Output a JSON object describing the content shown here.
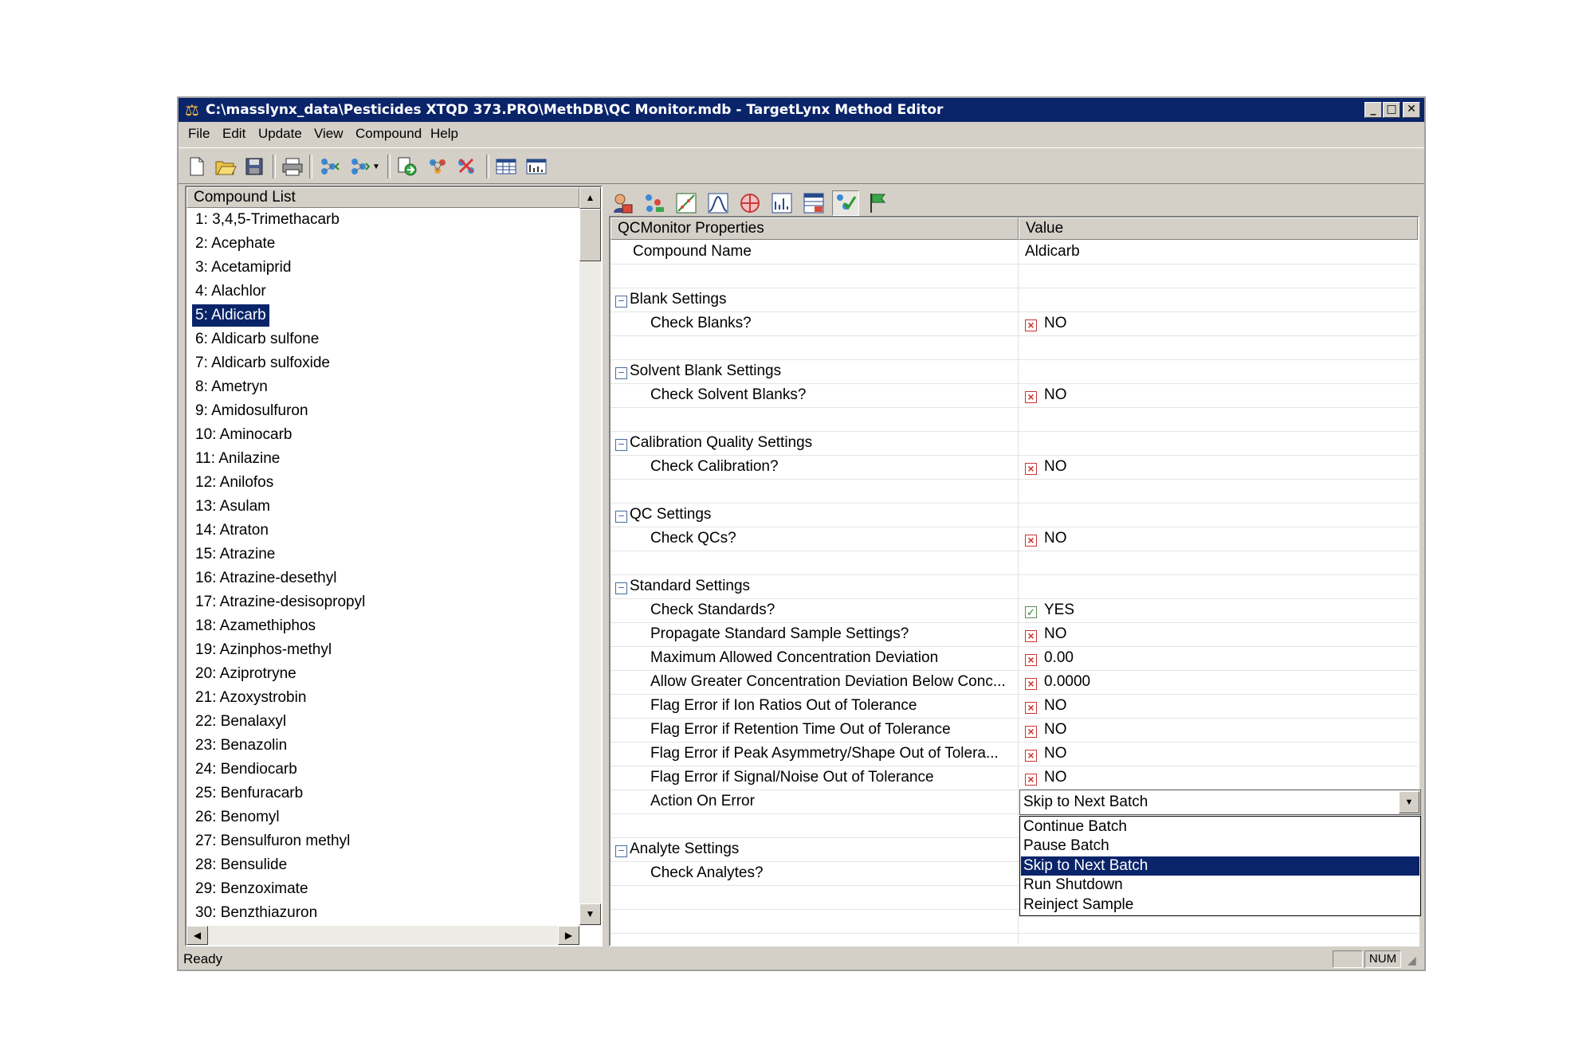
{
  "window": {
    "title": "C:\\masslynx_data\\Pesticides XTQD 373.PRO\\MethDB\\QC Monitor.mdb - TargetLynx Method Editor",
    "minimize_icon": "minimize-icon",
    "maximize_icon": "maximize-icon",
    "close_icon": "close-icon"
  },
  "menu": [
    "File",
    "Edit",
    "Update",
    "View",
    "Compound",
    "Help"
  ],
  "toolbar_icons": [
    "new-icon",
    "open-icon",
    "save-icon",
    "print-icon",
    "prev-compound-icon",
    "next-compound-icon",
    "dropdown-arrow-icon",
    "import-icon",
    "add-compound-icon",
    "delete-compound-icon",
    "table-view-icon",
    "chart-view-icon"
  ],
  "compound_list": {
    "header": "Compound List",
    "selected_index": 4,
    "items": [
      "1: 3,4,5-Trimethacarb",
      "2: Acephate",
      "3: Acetamiprid",
      "4: Alachlor",
      "5: Aldicarb",
      "6: Aldicarb sulfone",
      "7: Aldicarb sulfoxide",
      "8: Ametryn",
      "9: Amidosulfuron",
      "10: Aminocarb",
      "11: Anilazine",
      "12: Anilofos",
      "13: Asulam",
      "14: Atraton",
      "15: Atrazine",
      "16: Atrazine-desethyl",
      "17: Atrazine-desisopropyl",
      "18: Azamethiphos",
      "19: Azinphos-methyl",
      "20: Aziprotryne",
      "21: Azoxystrobin",
      "22: Benalaxyl",
      "23: Benazolin",
      "24: Bendiocarb",
      "25: Benfuracarb",
      "26: Benomyl",
      "27: Bensulfuron methyl",
      "28: Bensulide",
      "29: Benzoximate",
      "30: Benzthiazuron"
    ]
  },
  "property_toolbar_icons": [
    "compound-icon",
    "peaks-icon",
    "calibration-icon",
    "integration-icon",
    "target-icon",
    "report-icon",
    "database-icon",
    "qc-monitor-icon",
    "flag-icon"
  ],
  "grid": {
    "col_property": "QCMonitor Properties",
    "col_value": "Value",
    "rows": [
      {
        "type": "prop",
        "name": "Compound Name",
        "value": "Aldicarb",
        "check": ""
      },
      {
        "type": "blank"
      },
      {
        "type": "group",
        "name": "Blank Settings"
      },
      {
        "type": "prop",
        "name": "Check Blanks?",
        "value": "NO",
        "check": "x"
      },
      {
        "type": "blank"
      },
      {
        "type": "group",
        "name": "Solvent Blank Settings"
      },
      {
        "type": "prop",
        "name": "Check Solvent Blanks?",
        "value": "NO",
        "check": "x"
      },
      {
        "type": "blank"
      },
      {
        "type": "group",
        "name": "Calibration Quality Settings"
      },
      {
        "type": "prop",
        "name": "Check Calibration?",
        "value": "NO",
        "check": "x"
      },
      {
        "type": "blank"
      },
      {
        "type": "group",
        "name": "QC Settings"
      },
      {
        "type": "prop",
        "name": "Check QCs?",
        "value": "NO",
        "check": "x"
      },
      {
        "type": "blank"
      },
      {
        "type": "group",
        "name": "Standard Settings"
      },
      {
        "type": "prop",
        "name": "Check Standards?",
        "value": "YES",
        "check": "v"
      },
      {
        "type": "prop",
        "name": "Propagate Standard Sample Settings?",
        "value": "NO",
        "check": "x"
      },
      {
        "type": "prop",
        "name": "Maximum Allowed Concentration Deviation",
        "value": "0.00",
        "check": "x"
      },
      {
        "type": "prop",
        "name": "Allow Greater Concentration Deviation Below Conc...",
        "value": "0.0000",
        "check": "x"
      },
      {
        "type": "prop",
        "name": "Flag Error if Ion Ratios Out of Tolerance",
        "value": "NO",
        "check": "x"
      },
      {
        "type": "prop",
        "name": "Flag Error if Retention Time Out of Tolerance",
        "value": "NO",
        "check": "x"
      },
      {
        "type": "prop",
        "name": "Flag Error if Peak Asymmetry/Shape Out of Tolera...",
        "value": "NO",
        "check": "x"
      },
      {
        "type": "prop",
        "name": "Flag Error if Signal/Noise Out of Tolerance",
        "value": "NO",
        "check": "x"
      },
      {
        "type": "prop",
        "name": "Action On Error",
        "value": "",
        "check": ""
      },
      {
        "type": "blank"
      },
      {
        "type": "group",
        "name": "Analyte Settings"
      },
      {
        "type": "prop",
        "name": "Check Analytes?",
        "value": "",
        "check": ""
      },
      {
        "type": "blank"
      },
      {
        "type": "blank"
      }
    ]
  },
  "action_on_error": {
    "selected": "Skip to Next Batch",
    "options": [
      "Continue Batch",
      "Pause Batch",
      "Skip to Next Batch",
      "Run Shutdown",
      "Reinject Sample"
    ],
    "selected_index": 2
  },
  "status": {
    "text": "Ready",
    "num": "NUM"
  },
  "colors": {
    "titlebar": "#0a246a",
    "selection": "#0a246a",
    "chrome": "#d4d0c8"
  }
}
